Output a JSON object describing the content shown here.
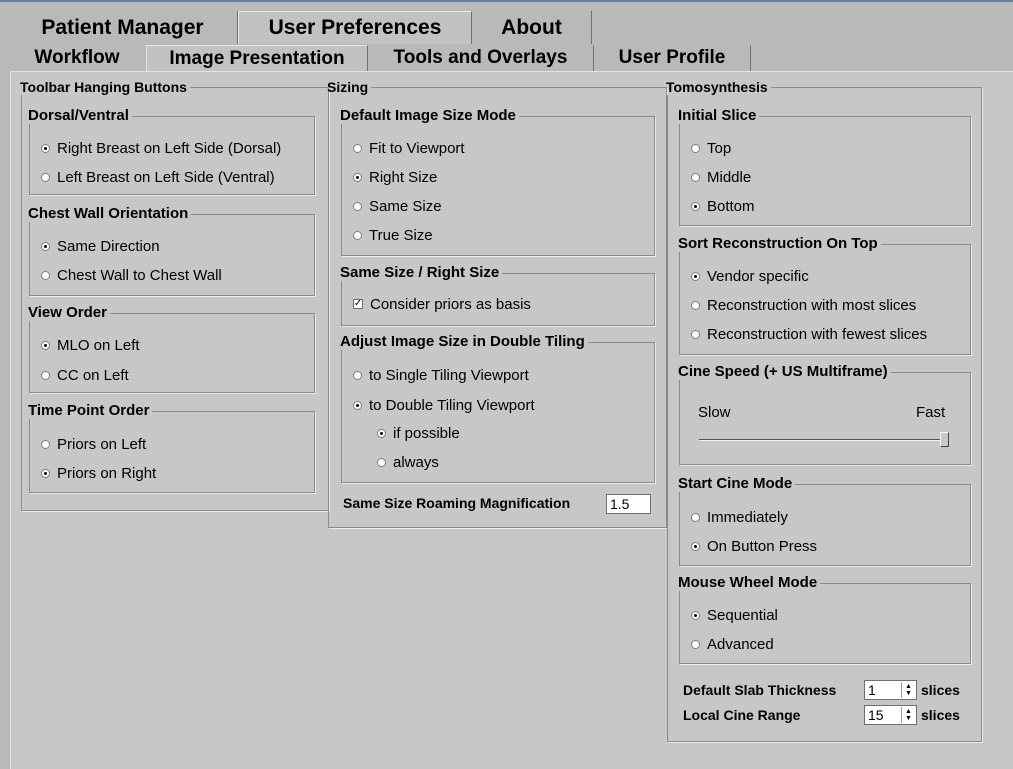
{
  "tabs_top": [
    {
      "label": "Patient Manager"
    },
    {
      "label": "User Preferences"
    },
    {
      "label": "About"
    }
  ],
  "tabs_sub": [
    {
      "label": "Workflow"
    },
    {
      "label": "Image Presentation"
    },
    {
      "label": "Tools and Overlays"
    },
    {
      "label": "User Profile"
    }
  ],
  "toolbar": {
    "title": "Toolbar Hanging Buttons",
    "dorsal": {
      "title": "Dorsal/Ventral",
      "options": [
        "Right Breast on Left Side (Dorsal)",
        "Left Breast on Left Side (Ventral)"
      ],
      "selected": 0
    },
    "chest": {
      "title": "Chest Wall Orientation",
      "options": [
        "Same Direction",
        "Chest Wall to Chest Wall"
      ],
      "selected": 0
    },
    "view": {
      "title": "View Order",
      "options": [
        "MLO on Left",
        "CC on Left"
      ],
      "selected": 0
    },
    "time": {
      "title": "Time Point Order",
      "options": [
        "Priors on Left",
        "Priors on Right"
      ],
      "selected": 1
    }
  },
  "sizing": {
    "title": "Sizing",
    "default_mode": {
      "title": "Default Image Size Mode",
      "options": [
        "Fit to Viewport",
        "Right Size",
        "Same Size",
        "True Size"
      ],
      "selected": 1
    },
    "same_right": {
      "title": "Same Size / Right Size",
      "check_label": "Consider priors as basis",
      "checked": true
    },
    "double": {
      "title": "Adjust Image Size in Double Tiling",
      "options": [
        "to Single Tiling Viewport",
        "to Double Tiling Viewport"
      ],
      "selected": 1,
      "sub_options": [
        "if possible",
        "always"
      ],
      "sub_selected": 0
    },
    "roaming_label": "Same Size Roaming Magnification",
    "roaming_value": "1.5"
  },
  "tomo": {
    "title": "Tomosynthesis",
    "initial": {
      "title": "Initial Slice",
      "options": [
        "Top",
        "Middle",
        "Bottom"
      ],
      "selected": 2
    },
    "sort": {
      "title": "Sort Reconstruction On Top",
      "options": [
        "Vendor specific",
        "Reconstruction with most slices",
        "Reconstruction with fewest slices"
      ],
      "selected": 0
    },
    "cine_speed": {
      "title": "Cine Speed (+ US Multiframe)",
      "slow": "Slow",
      "fast": "Fast",
      "value": 1.0
    },
    "start_cine": {
      "title": "Start Cine Mode",
      "options": [
        "Immediately",
        "On Button Press"
      ],
      "selected": 1
    },
    "wheel": {
      "title": "Mouse Wheel Mode",
      "options": [
        "Sequential",
        "Advanced"
      ],
      "selected": 0
    },
    "slab_label": "Default Slab Thickness",
    "slab_value": "1",
    "slab_unit": "slices",
    "range_label": "Local Cine Range",
    "range_value": "15",
    "range_unit": "slices"
  }
}
